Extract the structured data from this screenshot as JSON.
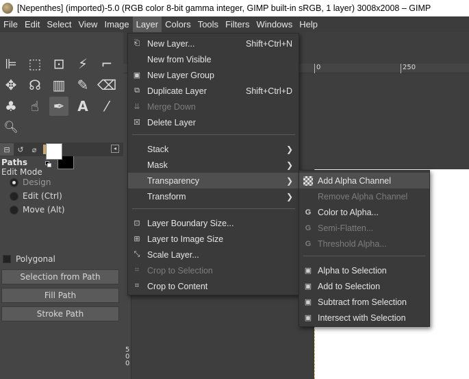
{
  "window": {
    "title": "[Nepenthes] (imported)-5.0 (RGB color 8-bit gamma integer, GIMP built-in sRGB, 1 layer) 3008x2008 – GIMP"
  },
  "menubar": {
    "items": [
      "File",
      "Edit",
      "Select",
      "View",
      "Image",
      "Layer",
      "Colors",
      "Tools",
      "Filters",
      "Windows",
      "Help"
    ],
    "active": "Layer"
  },
  "tool_options": {
    "title": "Paths",
    "mode_label": "Edit Mode",
    "modes": [
      {
        "label": "Design",
        "checked": true,
        "dim": true
      },
      {
        "label": "Edit (Ctrl)",
        "checked": false,
        "dim": false
      },
      {
        "label": "Move (Alt)",
        "checked": false,
        "dim": false
      }
    ],
    "polygonal": "Polygonal",
    "buttons": [
      "Selection from Path",
      "Fill Path",
      "Stroke Path"
    ]
  },
  "ruler": {
    "top_labels": [
      "0",
      "250"
    ],
    "left_labels": [
      "5",
      "0",
      "0"
    ]
  },
  "layer_menu": {
    "items": [
      {
        "label": "New Layer...",
        "accel": "Shift+Ctrl+N",
        "icon": "new-layer-icon",
        "glyph": "⎗"
      },
      {
        "label": "New from Visible",
        "icon": "",
        "glyph": ""
      },
      {
        "label": "New Layer Group",
        "icon": "layer-group-icon",
        "glyph": "▣"
      },
      {
        "label": "Duplicate Layer",
        "accel": "Shift+Ctrl+D",
        "icon": "duplicate-icon",
        "glyph": "⧉"
      },
      {
        "label": "Merge Down",
        "disabled": true,
        "icon": "merge-down-icon",
        "glyph": "⇊"
      },
      {
        "label": "Delete Layer",
        "icon": "delete-icon",
        "glyph": "☒"
      },
      {
        "label": "Stack",
        "submenu": true
      },
      {
        "label": "Mask",
        "submenu": true
      },
      {
        "label": "Transparency",
        "submenu": true,
        "highlighted": true
      },
      {
        "label": "Transform",
        "submenu": true
      },
      {
        "label": "Layer Boundary Size...",
        "icon": "boundary-size-icon",
        "glyph": "⊡"
      },
      {
        "label": "Layer to Image Size",
        "icon": "to-image-size-icon",
        "glyph": "⊞"
      },
      {
        "label": "Scale Layer...",
        "icon": "scale-icon",
        "glyph": "⤡"
      },
      {
        "label": "Crop to Selection",
        "disabled": true,
        "icon": "crop-icon",
        "glyph": "⌗"
      },
      {
        "label": "Crop to Content",
        "icon": "crop-content-icon",
        "glyph": "⌗"
      }
    ]
  },
  "transparency_menu": {
    "items": [
      {
        "label": "Add Alpha Channel",
        "highlighted": true,
        "icon": "alpha-checker-icon",
        "glyph": "▦"
      },
      {
        "label": "Remove Alpha Channel",
        "disabled": true,
        "icon": "",
        "glyph": ""
      },
      {
        "label": "Color to Alpha...",
        "icon": "gegl-icon",
        "glyph": "G"
      },
      {
        "label": "Semi-Flatten...",
        "disabled": true,
        "icon": "gegl-icon",
        "glyph": "G"
      },
      {
        "label": "Threshold Alpha...",
        "disabled": true,
        "icon": "gegl-icon",
        "glyph": "G"
      },
      {
        "label": "Alpha to Selection",
        "icon": "alpha-selection-icon",
        "glyph": "▣"
      },
      {
        "label": "Add to Selection",
        "icon": "add-selection-icon",
        "glyph": "▣"
      },
      {
        "label": "Subtract from Selection",
        "icon": "subtract-selection-icon",
        "glyph": "▣"
      },
      {
        "label": "Intersect with Selection",
        "icon": "intersect-selection-icon",
        "glyph": "▣"
      }
    ]
  },
  "tools": [
    {
      "name": "align-tool-icon",
      "glyph": "⊫"
    },
    {
      "name": "rect-select-tool-icon",
      "glyph": "⬚"
    },
    {
      "name": "foreground-select-tool-icon",
      "glyph": "⊡"
    },
    {
      "name": "fuzzy-select-tool-icon",
      "glyph": "⚡"
    },
    {
      "name": "crop-tool-icon",
      "glyph": "⌐"
    },
    {
      "name": "unified-transform-tool-icon",
      "glyph": "✥"
    },
    {
      "name": "warp-transform-tool-icon",
      "glyph": "☊"
    },
    {
      "name": "gradient-tool-icon",
      "glyph": "▥"
    },
    {
      "name": "paintbrush-tool-icon",
      "glyph": "✎"
    },
    {
      "name": "eraser-tool-icon",
      "glyph": "⌫"
    },
    {
      "name": "clone-tool-icon",
      "glyph": "♣"
    },
    {
      "name": "smudge-tool-icon",
      "glyph": "☝"
    },
    {
      "name": "paths-tool-icon",
      "glyph": "✒"
    },
    {
      "name": "text-tool-icon",
      "glyph": "A"
    },
    {
      "name": "color-picker-tool-icon",
      "glyph": "⁄"
    },
    {
      "name": "zoom-tool-icon",
      "glyph": "🔍︎"
    }
  ]
}
